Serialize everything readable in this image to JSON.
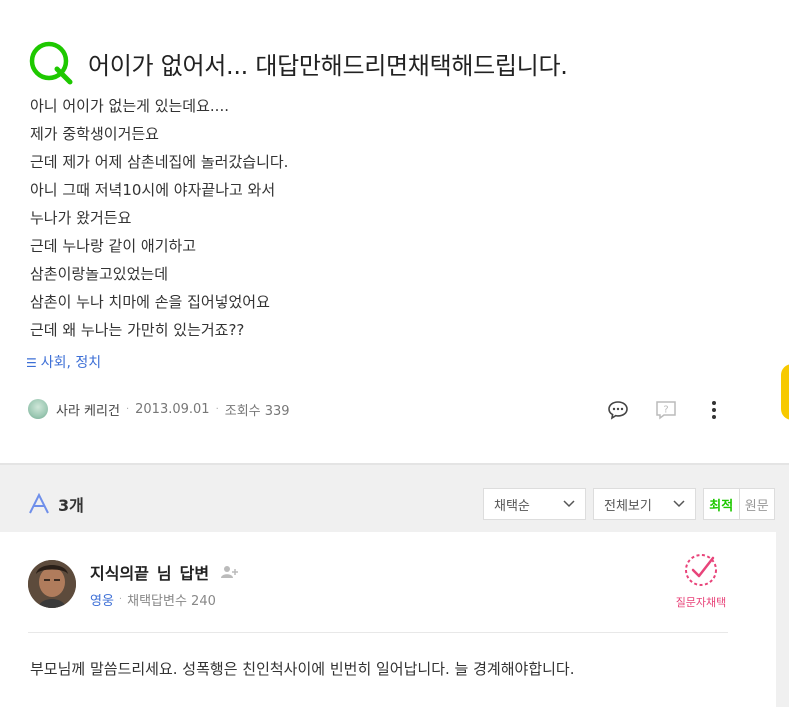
{
  "question": {
    "title": "어이가 없어서... 대답만해드리면채택해드립니다.",
    "body_lines": [
      "아니 어이가 없는게 있는데요....",
      "제가 중학생이거든요",
      "근데 제가 어제 삼촌네집에 놀러갔습니다.",
      "아니 그때 저녁10시에 야자끝나고 와서",
      "누나가 왔거든요",
      "근데 누나랑 같이 애기하고",
      "삼촌이랑놀고있었는데",
      "삼촌이 누나 치마에 손을 집어넣었어요",
      "근데 왜 누나는 가만히 있는거죠??"
    ],
    "category": "사회, 정치",
    "category_icon": "list-icon",
    "author": "사라 케리건",
    "date": "2013.09.01",
    "views": "조회수 339"
  },
  "answers_header": {
    "count": "3개",
    "sort_select": "채택순",
    "filter_select": "전체보기",
    "toggle_latest": "최적",
    "toggle_original": "원문"
  },
  "answer": {
    "name": "지식의끝",
    "honorific": "님",
    "label": "답변",
    "grade": "영웅",
    "adopted_count": "채택답변수 240",
    "chosen_label": "질문자채택",
    "text": "부모님께 말씀드리세요. 성폭행은 친인척사이에 빈번히 일어납니다. 늘 경계해야합니다."
  },
  "colors": {
    "q_logo": "#1ec800",
    "accent_blue": "#3d6fd6",
    "chosen_pink": "#e8447a",
    "edge_badge": "#f7c900"
  }
}
